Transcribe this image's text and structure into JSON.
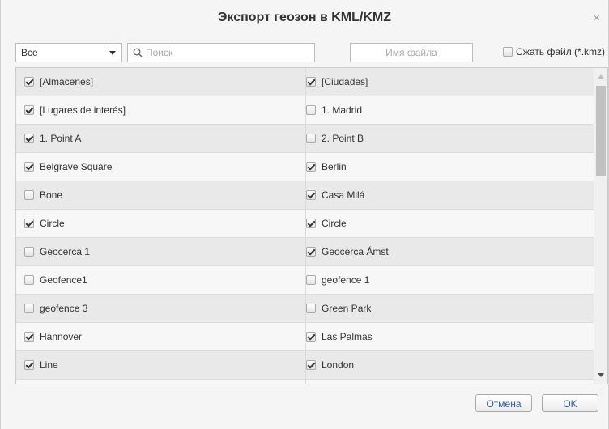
{
  "dialog": {
    "title": "Экспорт геозон в KML/KMZ",
    "close_glyph": "×"
  },
  "toolbar": {
    "filter_value": "Все",
    "search_placeholder": "Поиск",
    "filename_placeholder": "Имя файла",
    "compress_label": "Сжать файл (*.kmz)",
    "compress_checked": false
  },
  "rows": [
    {
      "left": {
        "label": "[Almacenes]",
        "checked": true
      },
      "right": {
        "label": "[Ciudades]",
        "checked": true
      }
    },
    {
      "left": {
        "label": "[Lugares de interés]",
        "checked": true
      },
      "right": {
        "label": "1. Madrid",
        "checked": false
      }
    },
    {
      "left": {
        "label": "1. Point A",
        "checked": true
      },
      "right": {
        "label": "2. Point B",
        "checked": false
      }
    },
    {
      "left": {
        "label": "Belgrave Square",
        "checked": true
      },
      "right": {
        "label": "Berlin",
        "checked": true
      }
    },
    {
      "left": {
        "label": "Bone",
        "checked": false
      },
      "right": {
        "label": "Casa Milá",
        "checked": true
      }
    },
    {
      "left": {
        "label": "Circle",
        "checked": true
      },
      "right": {
        "label": "Circle",
        "checked": true
      }
    },
    {
      "left": {
        "label": "Geocerca 1",
        "checked": false
      },
      "right": {
        "label": "Geocerca Ámst.",
        "checked": true
      }
    },
    {
      "left": {
        "label": "Geofence1",
        "checked": false
      },
      "right": {
        "label": "geofence 1",
        "checked": false
      }
    },
    {
      "left": {
        "label": "geofence 3",
        "checked": false
      },
      "right": {
        "label": "Green Park",
        "checked": false
      }
    },
    {
      "left": {
        "label": "Hannover",
        "checked": true
      },
      "right": {
        "label": "Las Palmas",
        "checked": true
      }
    },
    {
      "left": {
        "label": "Line",
        "checked": true
      },
      "right": {
        "label": "London",
        "checked": true
      }
    },
    {
      "left": {
        "label": "",
        "checked": false
      },
      "right": {
        "label": "",
        "checked": false
      }
    }
  ],
  "footer": {
    "cancel_label": "Отмена",
    "ok_label": "OK"
  }
}
